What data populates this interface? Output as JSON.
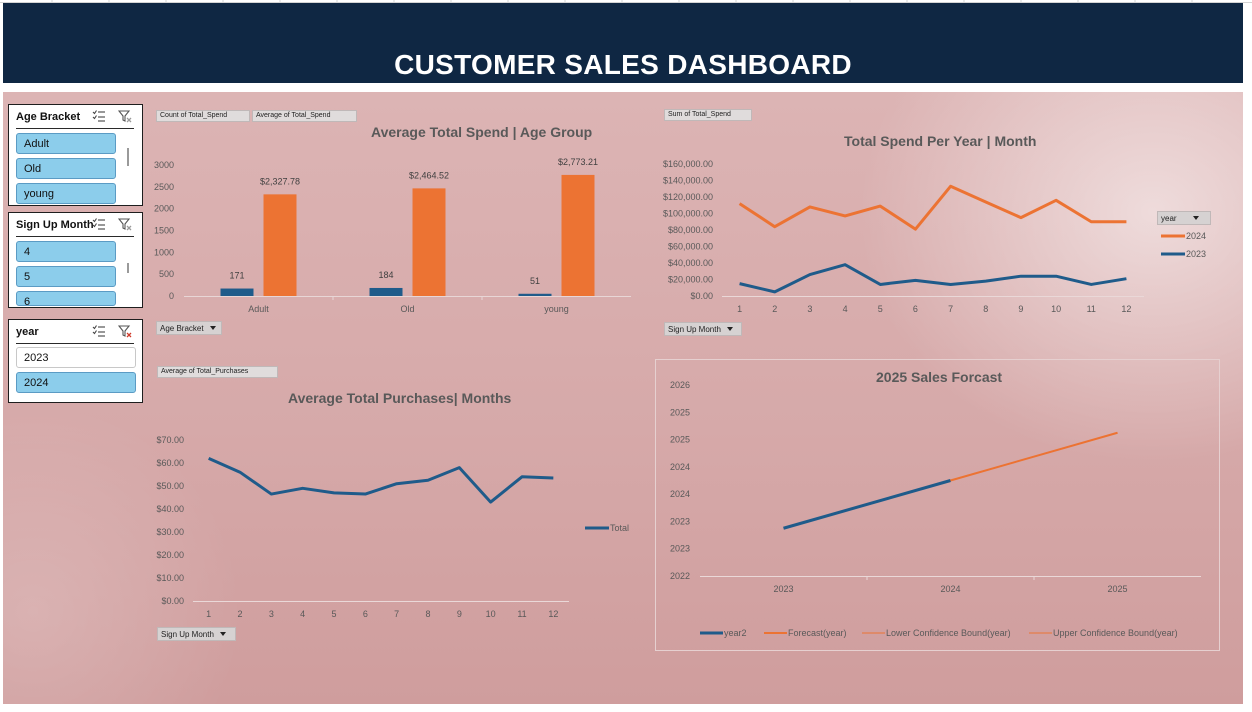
{
  "dashboard": {
    "title": "CUSTOMER SALES DASHBOARD"
  },
  "colors": {
    "banner": "#0f2743",
    "navy_series": "#1f5b8a",
    "orange_series": "#ec7333",
    "chip": "#8ccdeb",
    "background": "#d6a9a9"
  },
  "slicers": {
    "age": {
      "title": "Age Bracket",
      "items": [
        {
          "label": "Adult",
          "selected": true
        },
        {
          "label": "Old",
          "selected": true
        },
        {
          "label": "young",
          "selected": true
        }
      ]
    },
    "month": {
      "title": "Sign Up Month",
      "items": [
        {
          "label": "4",
          "selected": true
        },
        {
          "label": "5",
          "selected": true
        },
        {
          "label": "6",
          "selected": true
        }
      ]
    },
    "year": {
      "title": "year",
      "items": [
        {
          "label": "2023",
          "selected": false
        },
        {
          "label": "2024",
          "selected": true
        }
      ]
    },
    "icons": [
      "multi-select-icon",
      "clear-filter-icon"
    ]
  },
  "charts": {
    "age_group": {
      "buttons": {
        "value1": "Count of Total_Spend",
        "value2": "Average of Total_Spend",
        "axis": "Age Bracket"
      }
    },
    "spend_year": {
      "buttons": {
        "value": "Sum of Total_Spend",
        "legend": "year",
        "axis": "Sign Up Month"
      }
    },
    "purchases": {
      "buttons": {
        "value": "Average of Total_Purchases",
        "axis": "Sign Up Month"
      }
    },
    "forecast": {}
  },
  "chart_data": [
    {
      "type": "bar",
      "title": "Average Total Spend | Age Group",
      "categories": [
        "Adult",
        "Old",
        "young"
      ],
      "series": [
        {
          "name": "Count of Total_Spend",
          "values": [
            171,
            184,
            51
          ],
          "labels": [
            "171",
            "184",
            "51"
          ],
          "color": "#1f5b8a"
        },
        {
          "name": "Average of Total_Spend",
          "values": [
            2327.78,
            2464.52,
            2773.21
          ],
          "labels": [
            "$2,327.78",
            "$2,464.52",
            "$2,773.21"
          ],
          "color": "#ec7333"
        }
      ],
      "ylim": [
        0,
        3000
      ],
      "yticks": [
        "0",
        "500",
        "1000",
        "1500",
        "2000",
        "2500",
        "3000"
      ],
      "grid": false
    },
    {
      "type": "line",
      "title": "Total Spend Per Year | Month",
      "x": [
        "1",
        "2",
        "3",
        "4",
        "5",
        "6",
        "7",
        "8",
        "9",
        "10",
        "11",
        "12"
      ],
      "series": [
        {
          "name": "2024",
          "values": [
            112000,
            84000,
            108000,
            97000,
            109000,
            81000,
            133000,
            114000,
            95000,
            116000,
            90000,
            90000
          ],
          "color": "#ec7333"
        },
        {
          "name": "2023",
          "values": [
            15000,
            5000,
            26000,
            38000,
            14000,
            19000,
            14000,
            18000,
            24000,
            24000,
            14000,
            21000
          ],
          "color": "#1f5b8a"
        }
      ],
      "ylim": [
        0,
        160000
      ],
      "yticks": [
        "$0.00",
        "$20,000.00",
        "$40,000.00",
        "$60,000.00",
        "$80,000.00",
        "$100,000.00",
        "$120,000.00",
        "$140,000.00",
        "$160,000.00"
      ],
      "legend": "right",
      "legend_title": "year"
    },
    {
      "type": "line",
      "title": "Average Total Purchases| Months",
      "x": [
        "1",
        "2",
        "3",
        "4",
        "5",
        "6",
        "7",
        "8",
        "9",
        "10",
        "11",
        "12"
      ],
      "series": [
        {
          "name": "Total",
          "values": [
            62,
            56,
            46.5,
            49,
            47,
            46.5,
            51,
            52.5,
            58,
            43,
            54,
            53.5
          ],
          "color": "#1f5b8a"
        }
      ],
      "ylim": [
        0,
        70
      ],
      "yticks": [
        "$0.00",
        "$10.00",
        "$20.00",
        "$30.00",
        "$40.00",
        "$50.00",
        "$60.00",
        "$70.00"
      ],
      "legend": "right"
    },
    {
      "type": "line",
      "title": "2025 Sales Forcast",
      "x": [
        "2023",
        "2024",
        "2025"
      ],
      "series": [
        {
          "name": "year2",
          "values": [
            2023,
            2024,
            null
          ],
          "color": "#1f5b8a"
        },
        {
          "name": "Forecast(year)",
          "values": [
            null,
            2024,
            2025
          ],
          "color": "#ec7333"
        },
        {
          "name": "Lower Confidence Bound(year)",
          "values": [
            null,
            2024,
            2025
          ],
          "color": "#ec7333"
        },
        {
          "name": "Upper Confidence Bound(year)",
          "values": [
            null,
            2024,
            2025
          ],
          "color": "#ec7333"
        }
      ],
      "ylim": [
        2022,
        2026
      ],
      "yticks": [
        "2022",
        "2023",
        "2023",
        "2024",
        "2024",
        "2025",
        "2025",
        "2026"
      ],
      "legend": "bottom"
    }
  ]
}
